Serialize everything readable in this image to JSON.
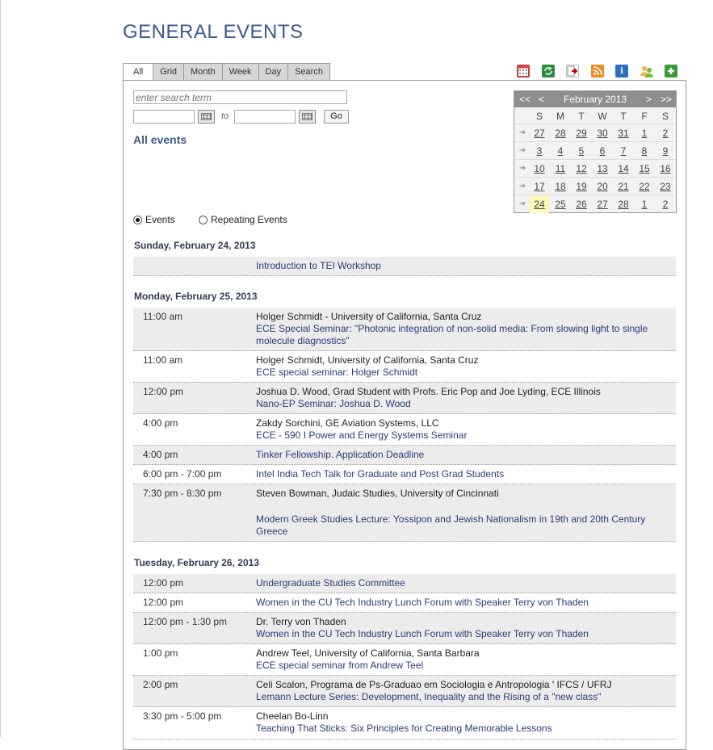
{
  "page_title": "GENERAL EVENTS",
  "tabs": [
    "All",
    "Grid",
    "Month",
    "Week",
    "Day",
    "Search"
  ],
  "toolbar_icons": [
    "calendar-icon",
    "sync-icon",
    "export-icon",
    "rss-icon",
    "info-icon",
    "users-icon",
    "add-icon"
  ],
  "search": {
    "placeholder": "enter search term",
    "to_label": "to",
    "go_label": "Go"
  },
  "list_heading": "All events",
  "view_options": {
    "events": "Events",
    "repeating": "Repeating Events",
    "selected": "Events"
  },
  "mini_calendar": {
    "month_label": "February 2013",
    "prev_year": "<<",
    "prev_month": "<",
    "next_month": ">",
    "next_year": ">>",
    "weekdays": [
      "S",
      "M",
      "T",
      "W",
      "T",
      "F",
      "S"
    ],
    "weeks": [
      [
        "27",
        "28",
        "29",
        "30",
        "31",
        "1",
        "2"
      ],
      [
        "3",
        "4",
        "5",
        "6",
        "7",
        "8",
        "9"
      ],
      [
        "10",
        "11",
        "12",
        "13",
        "14",
        "15",
        "16"
      ],
      [
        "17",
        "18",
        "19",
        "20",
        "21",
        "22",
        "23"
      ],
      [
        "24",
        "25",
        "26",
        "27",
        "28",
        "1",
        "2"
      ]
    ],
    "today": "24"
  },
  "days": [
    {
      "label": "Sunday, February 24, 2013",
      "events": [
        {
          "time": "",
          "who": "",
          "title": "Introduction to TEI Workshop"
        }
      ]
    },
    {
      "label": "Monday, February 25, 2013",
      "events": [
        {
          "time": "11:00 am",
          "who": "Holger Schmidt - University of California, Santa Cruz",
          "title": "ECE Special Seminar: \"Photonic integration of non-solid media: From slowing light to single molecule diagnostics\""
        },
        {
          "time": "11:00 am",
          "who": "Holger Schmidt, University of California, Santa Cruz",
          "title": "ECE special seminar: Holger Schmidt"
        },
        {
          "time": "12:00 pm",
          "who": "Joshua D. Wood, Grad Student with Profs. Eric Pop and Joe Lyding, ECE Illinois",
          "title": "Nano-EP Seminar: Joshua D. Wood"
        },
        {
          "time": "4:00 pm",
          "who": "Zakdy Sorchini, GE Aviation Systems, LLC",
          "title": "ECE - 590 I Power and Energy Systems Seminar"
        },
        {
          "time": "4:00 pm",
          "who": "",
          "title": "Tinker Fellowship. Application Deadline"
        },
        {
          "time": "6:00 pm - 7:00 pm",
          "who": "",
          "title": "Intel India Tech Talk for Graduate and Post Grad Students"
        },
        {
          "time": "7:30 pm - 8:30 pm",
          "who": "Steven Bowman, Judaic Studies, University of Cincinnati",
          "title": "Modern Greek Studies Lecture: Yossipon and Jewish Nationalism in 19th and 20th Century Greece"
        }
      ]
    },
    {
      "label": "Tuesday, February 26, 2013",
      "events": [
        {
          "time": "12:00 pm",
          "who": "",
          "title": "Undergraduate Studies Committee"
        },
        {
          "time": "12:00 pm",
          "who": "",
          "title": "Women in the CU Tech Industry Lunch Forum with Speaker Terry von Thaden"
        },
        {
          "time": "12:00 pm - 1:30 pm",
          "who": "Dr. Terry von Thaden",
          "title": "Women in the CU Tech Industry Lunch Forum with Speaker Terry von Thaden"
        },
        {
          "time": "1:00 pm",
          "who": "Andrew Teel, University of California, Santa Barbara",
          "title": "ECE special seminar from Andrew Teel"
        },
        {
          "time": "2:00 pm",
          "who": "Celi Scalon, Programa de Ps-Graduao em Sociologia e Antropologia ' IFCS / UFRJ",
          "title": "Lemann Lecture Series: Development, Inequality and the Rising of a \"new class\""
        },
        {
          "time": "3:30 pm - 5:00 pm",
          "who": "Cheelan Bo-Linn",
          "title": "Teaching That Sticks: Six Principles for Creating Memorable Lessons"
        }
      ]
    }
  ]
}
